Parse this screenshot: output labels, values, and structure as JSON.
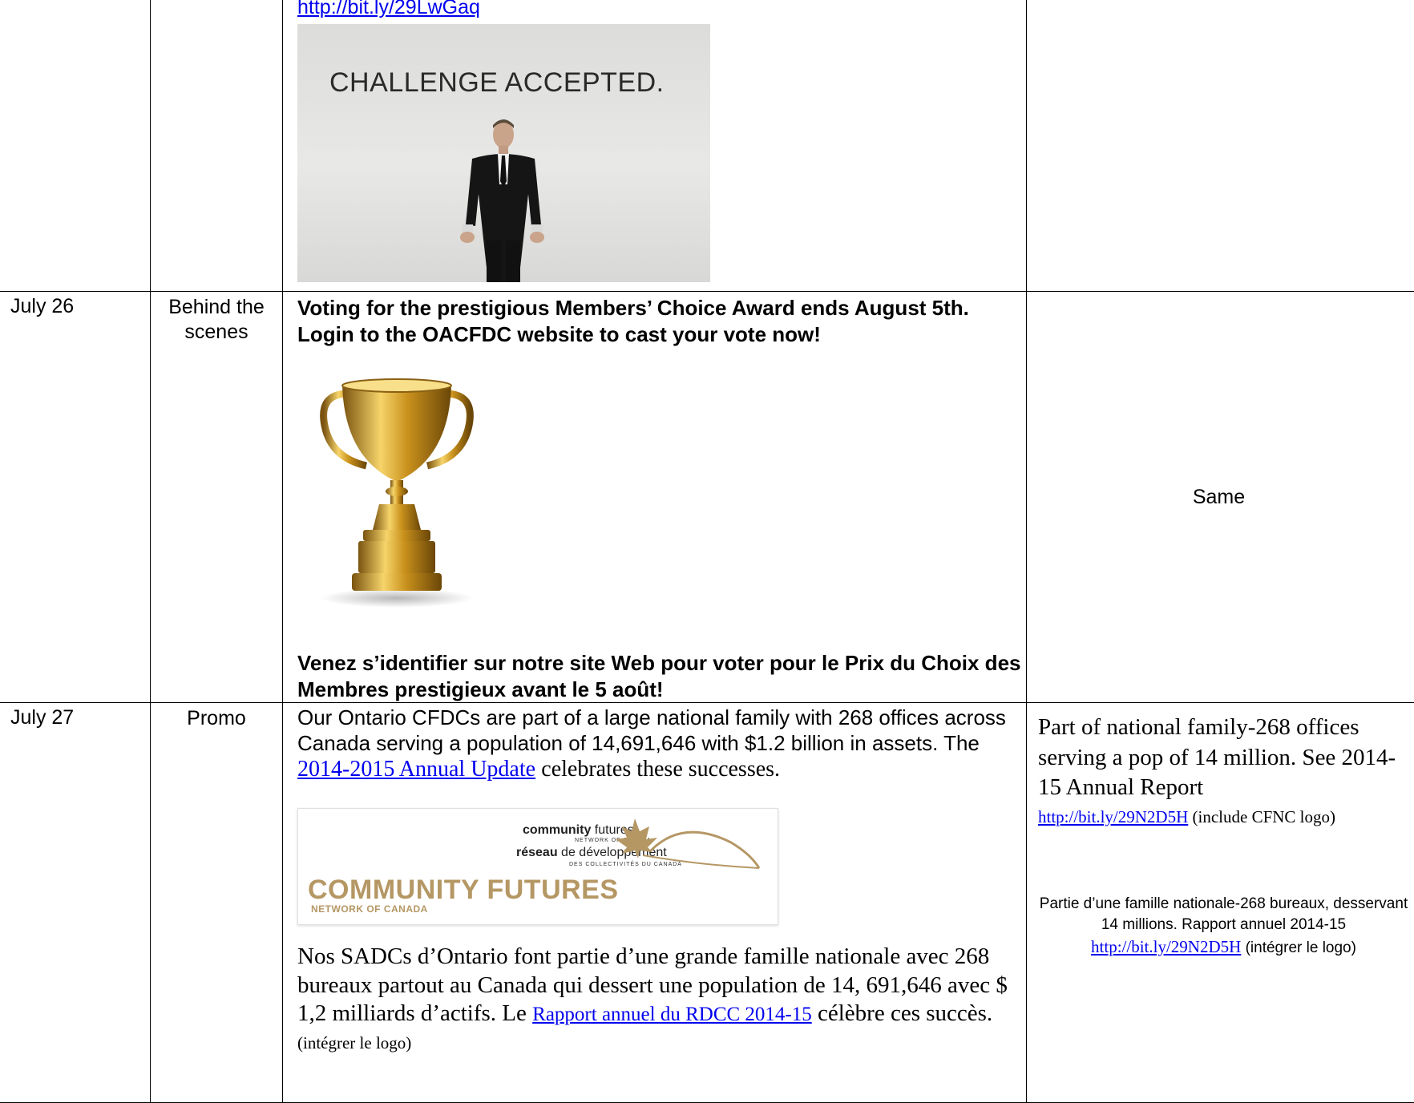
{
  "rows": [
    {
      "date": "",
      "type": "",
      "link": "http://bit.ly/29LwGaq",
      "image_caption": "CHALLENGE ACCEPTED.",
      "twitter": ""
    },
    {
      "date": "July 26",
      "type": "Behind the scenes",
      "en_text": "Voting for the prestigious Members’ Choice Award ends August 5th. Login to the OACFDC website to cast your vote now!",
      "fr_text": "Venez s’identifier sur notre site Web pour voter pour le Prix du Choix des Membres prestigieux avant le 5 août!",
      "twitter": "Same"
    },
    {
      "date": "July 27",
      "type": "Promo",
      "en_text_1": "Our Ontario CFDCs are part of a large national family with 268 offices across Canada serving a population of 14,691,646 with $1.2 billion in assets. The",
      "en_link": "2014-2015 Annual Update",
      "en_text_2": "celebrates these successes.",
      "logo": {
        "cf": "community",
        "cf_bold": "futures",
        "cf_sub": "NETWORK OF CANADA",
        "reseau_bold": "réseau",
        "reseau": "de développement",
        "reseau_sub": "DES COLLECTIVITÉS   DU CANADA",
        "big": "COMMUNITY FUTURES",
        "big_sub": "NETWORK OF CANADA"
      },
      "fr_text_1": "Nos SADCs d’Ontario font partie d’une grande famille nationale avec 268 bureaux partout au Canada qui dessert une population de 14, 691,646 avec $ 1,2 milliards d’actifs. Le",
      "fr_link": "Rapport annuel du RDCC 2014-15",
      "fr_text_2": "célèbre ces succès.",
      "fr_note": "(intégrer le logo)",
      "tw_en": "Part of national family-268 offices serving a pop of 14 million. See 2014-15 Annual Report",
      "tw_en_link": "http://bit.ly/29N2D5H",
      "tw_en_note": "(include CFNC logo)",
      "tw_fr": "Partie d’une famille nationale-268 bureaux, desservant 14 millions. Rapport annuel 2014-15",
      "tw_fr_link": "http://bit.ly/29N2D5H",
      "tw_fr_note": "(intégrer le logo)"
    }
  ]
}
